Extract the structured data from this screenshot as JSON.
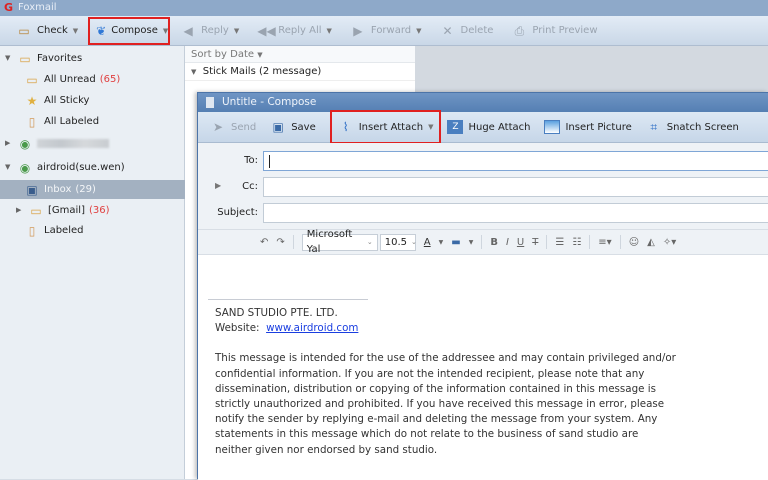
{
  "app": {
    "title": "Foxmail"
  },
  "toolbar": {
    "check": "Check",
    "compose": "Compose",
    "reply": "Reply",
    "reply_all": "Reply All",
    "forward": "Forward",
    "delete": "Delete",
    "print_preview": "Print Preview"
  },
  "sidebar": {
    "favorites": "Favorites",
    "all_unread": "All Unread",
    "all_unread_count": "(65)",
    "all_sticky": "All Sticky",
    "all_labeled": "All Labeled",
    "account": "airdroid(sue.wen)",
    "inbox": "Inbox",
    "inbox_count": "(29)",
    "gmail": "[Gmail]",
    "gmail_count": "(36)",
    "labeled": "Labeled"
  },
  "maillist": {
    "sort": "Sort by Date",
    "group": "Stick Mails (2 message)"
  },
  "compose": {
    "title": "Untitle - Compose",
    "toolbar": {
      "send": "Send",
      "save": "Save",
      "insert_attach": "Insert Attach",
      "huge_attach": "Huge Attach",
      "insert_picture": "Insert Picture",
      "snatch_screen": "Snatch Screen"
    },
    "fields": {
      "to": "To:",
      "cc": "Cc:",
      "subject": "Subject:"
    },
    "format": {
      "font": "Microsoft Yal",
      "size": "10.5"
    },
    "body": {
      "company": "SAND STUDIO PTE. LTD.",
      "website_label": "Website:",
      "website": "www.airdroid.com",
      "disclaimer": [
        "This message is intended for the use of the addressee and may contain privileged and/or",
        "confidential information. If you are not the intended recipient, please note that any",
        "dissemination, distribution or copying of the information contained in this message is",
        "strictly unauthorized and prohibited. If you have received this message in error, please",
        "notify the sender by replying e-mail and deleting the message from your system. Any",
        "statements in this message which do not relate to the business of sand studio are",
        "neither given nor endorsed by sand studio."
      ]
    }
  }
}
